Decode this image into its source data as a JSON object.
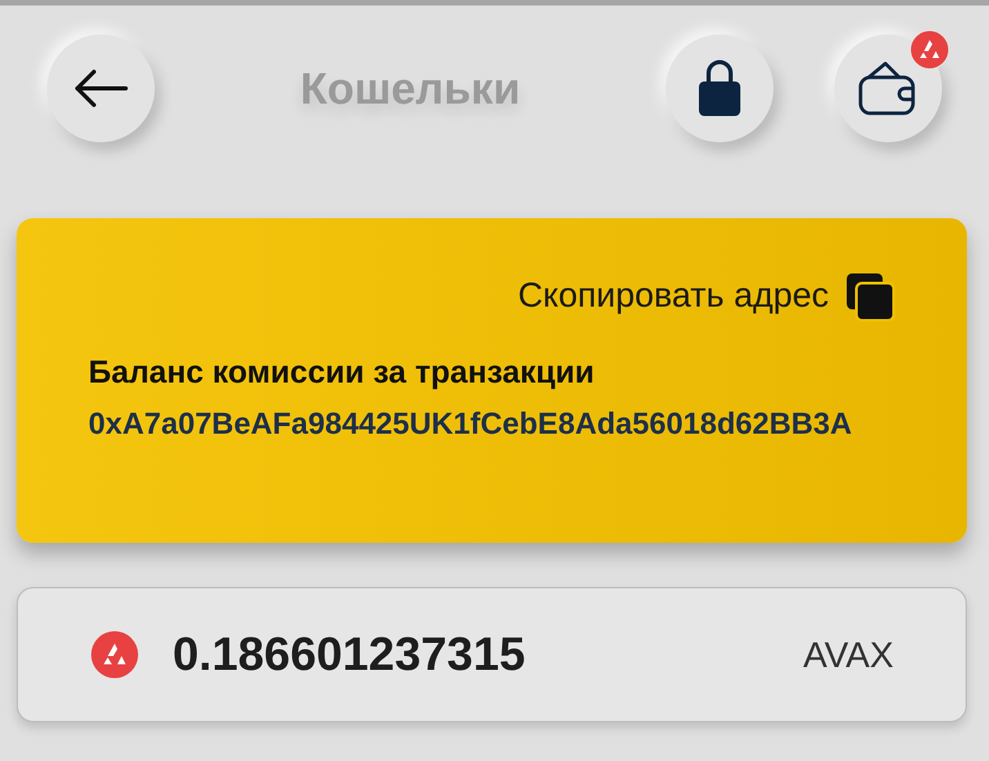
{
  "header": {
    "title": "Кошельки",
    "notification_badge": true
  },
  "wallet_card": {
    "copy_label": "Скопировать адрес",
    "title": "Баланс комиссии за транзакции",
    "address": "0xA7a07BeAFa984425UK1fCebE8Ada56018d62BB3A"
  },
  "balance": {
    "amount": "0.186601237315",
    "currency": "AVAX"
  }
}
